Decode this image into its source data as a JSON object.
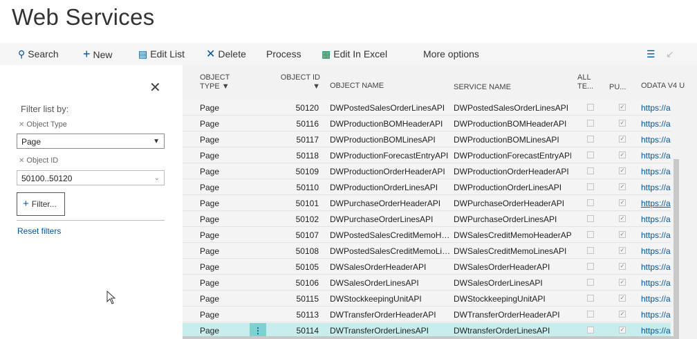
{
  "page": {
    "title": "Web Services"
  },
  "toolbar": {
    "search": {
      "icon": "search-icon",
      "label": "Search"
    },
    "new": {
      "icon": "plus-icon",
      "label": "New"
    },
    "edit_list": {
      "icon": "edit-list-icon",
      "label": "Edit List"
    },
    "delete": {
      "icon": "delete-x-icon",
      "label": "Delete"
    },
    "process": {
      "label": "Process"
    },
    "edit_excel": {
      "icon": "excel-icon",
      "label": "Edit In Excel"
    },
    "more": {
      "label": "More options"
    }
  },
  "filter_pane": {
    "heading": "Filter list by:",
    "fields": [
      {
        "label": "Object Type",
        "value": "Page"
      },
      {
        "label": "Object ID",
        "value": "50100..50120"
      }
    ],
    "add_filter": "Filter...",
    "reset": "Reset filters"
  },
  "grid": {
    "columns": {
      "object_type": "OBJECT TYPE",
      "object_id": "OBJECT ID",
      "object_name": "OBJECT NAME",
      "service_name": "SERVICE NAME",
      "all_tenants": "ALL TE...",
      "published": "PU...",
      "odata": "ODATA V4 U"
    },
    "rows": [
      {
        "type": "Page",
        "id": "50120",
        "name": "DWPostedSalesOrderLinesAPI",
        "service": "DWPostedSalesOrderLinesAPI",
        "url": "https://a"
      },
      {
        "type": "Page",
        "id": "50116",
        "name": "DWProductionBOMHeaderAPI",
        "service": "DWProductionBOMHeaderAPI",
        "url": "https://a"
      },
      {
        "type": "Page",
        "id": "50117",
        "name": "DWProductionBOMLinesAPI",
        "service": "DWProductionBOMLinesAPI",
        "url": "https://a"
      },
      {
        "type": "Page",
        "id": "50118",
        "name": "DWProductionForecastEntryAPI",
        "service": "DWProductionForecastEntryAPI",
        "url": "https://a"
      },
      {
        "type": "Page",
        "id": "50109",
        "name": "DWProductionOrderHeaderAPI",
        "service": "DWProductionOrderHeaderAPI",
        "url": "https://a"
      },
      {
        "type": "Page",
        "id": "50110",
        "name": "DWProductionOrderLinesAPI",
        "service": "DWProductionOrderLinesAPI",
        "url": "https://a"
      },
      {
        "type": "Page",
        "id": "50101",
        "name": "DWPurchaseOrderHeaderAPI",
        "service": "DWPurchaseOrderHeaderAPI",
        "url": "https://a"
      },
      {
        "type": "Page",
        "id": "50102",
        "name": "DWPurchaseOrderLinesAPI",
        "service": "DWPurchaseOrderLinesAPI",
        "url": "https://a"
      },
      {
        "type": "Page",
        "id": "50107",
        "name": "DWPostedSalesCreditMemoHe...",
        "service": "DWSalesCreditMemoHeaderAPI",
        "url": "https://a"
      },
      {
        "type": "Page",
        "id": "50108",
        "name": "DWPostedSalesCreditMemoLin...",
        "service": "DWSalesCreditMemoLinesAPI",
        "url": "https://a"
      },
      {
        "type": "Page",
        "id": "50105",
        "name": "DWSalesOrderHeaderAPI",
        "service": "DWSalesOrderHeaderAPI",
        "url": "https://a"
      },
      {
        "type": "Page",
        "id": "50106",
        "name": "DWSalesOrderLinesAPI",
        "service": "DWSalesOrderLinesAPI",
        "url": "https://a"
      },
      {
        "type": "Page",
        "id": "50115",
        "name": "DWStockkeepingUnitAPI",
        "service": "DWStockkeepingUnitAPI",
        "url": "https://a"
      },
      {
        "type": "Page",
        "id": "50113",
        "name": "DWTransferOrderHeaderAPI",
        "service": "DWTransferOrderHeaderAPI",
        "url": "https://a"
      },
      {
        "type": "Page",
        "id": "50114",
        "name": "DWTransferOrderLinesAPI",
        "service": "DWtransferOrderLinesAPI",
        "url": "https://a"
      }
    ]
  }
}
